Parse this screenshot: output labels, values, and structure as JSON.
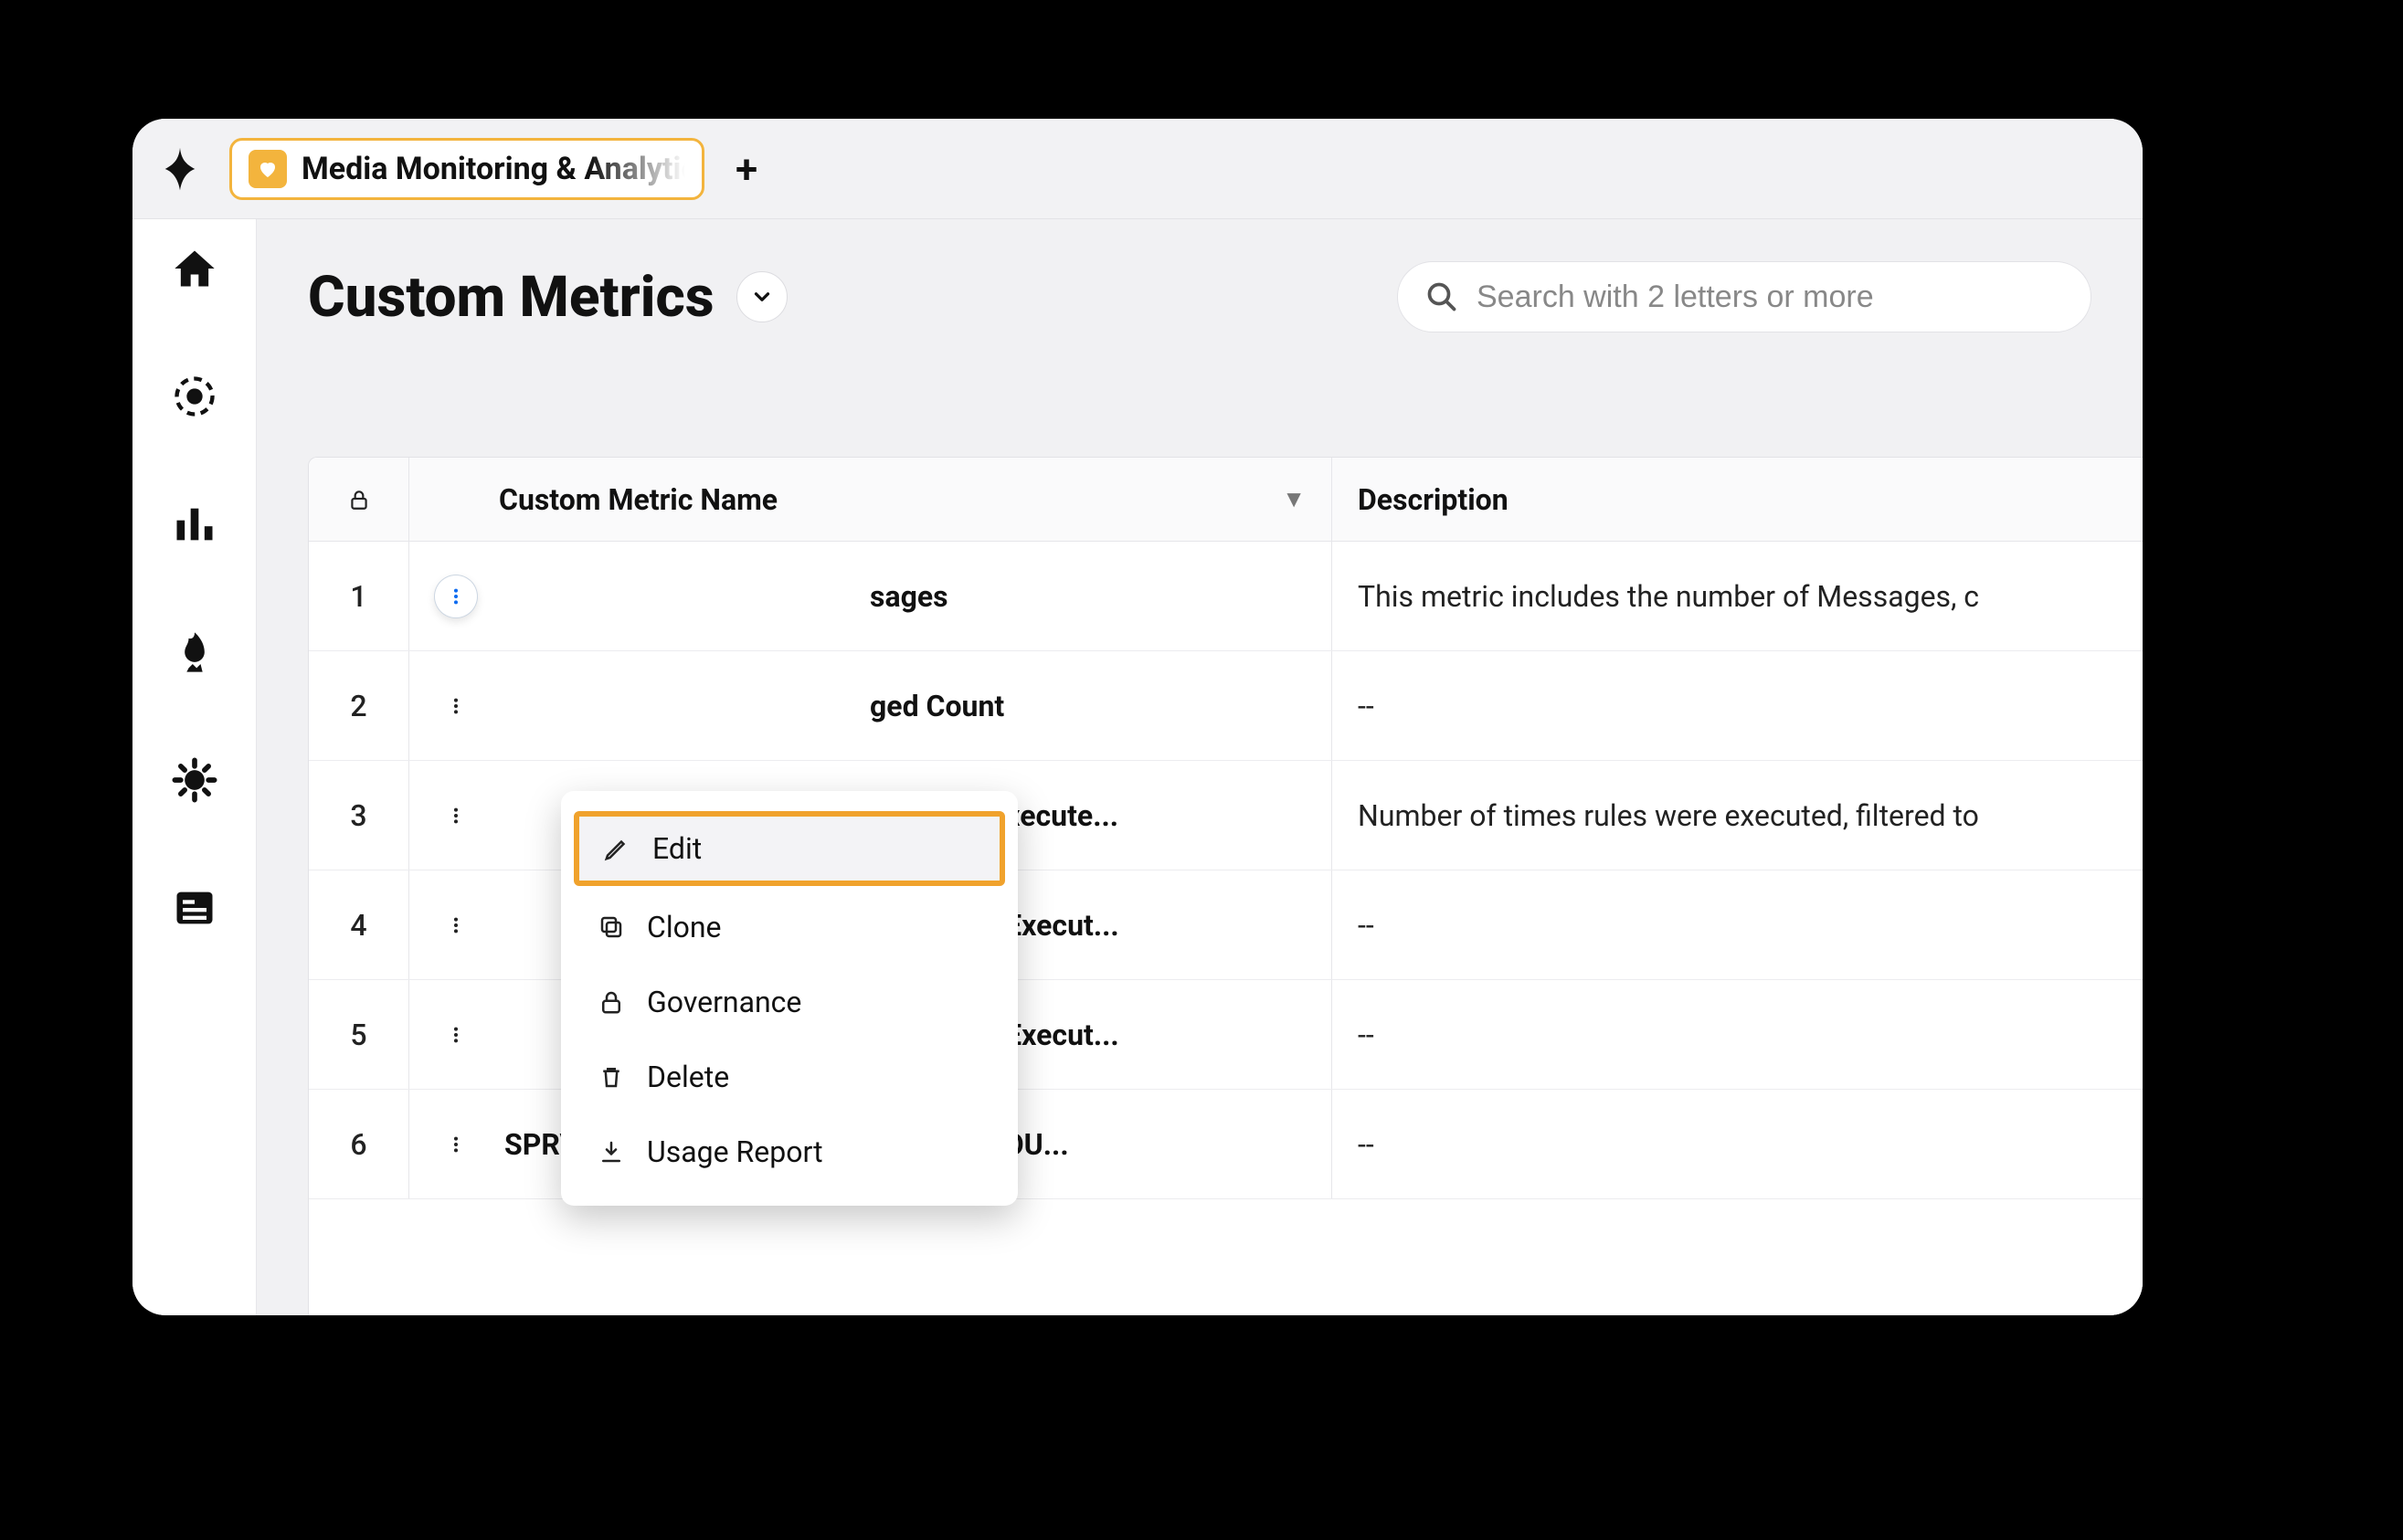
{
  "tab": {
    "label": "Media Monitoring & Analytics"
  },
  "page": {
    "title": "Custom Metrics"
  },
  "search": {
    "placeholder": "Search with 2 letters or more"
  },
  "columns": {
    "name": "Custom Metric Name",
    "desc": "Description"
  },
  "menu": {
    "edit": "Edit",
    "clone": "Clone",
    "governance": "Governance",
    "delete": "Delete",
    "usage": "Usage Report"
  },
  "rows": [
    {
      "idx": "1",
      "name": "sages",
      "desc": "This metric includes the number of Messages, c"
    },
    {
      "idx": "2",
      "name": "ged Count",
      "desc": "--"
    },
    {
      "idx": "3",
      "name": "es Rules Execute...",
      "desc": "Number of times rules were executed, filtered to"
    },
    {
      "idx": "4",
      "name": "nes Rules Execut...",
      "desc": "--"
    },
    {
      "idx": "5",
      "name": "nes Rules Execut...",
      "desc": "--"
    },
    {
      "idx": "6",
      "name": "SPRV_ME Custom Fields Count_OUTBOU...",
      "desc": "--"
    }
  ]
}
